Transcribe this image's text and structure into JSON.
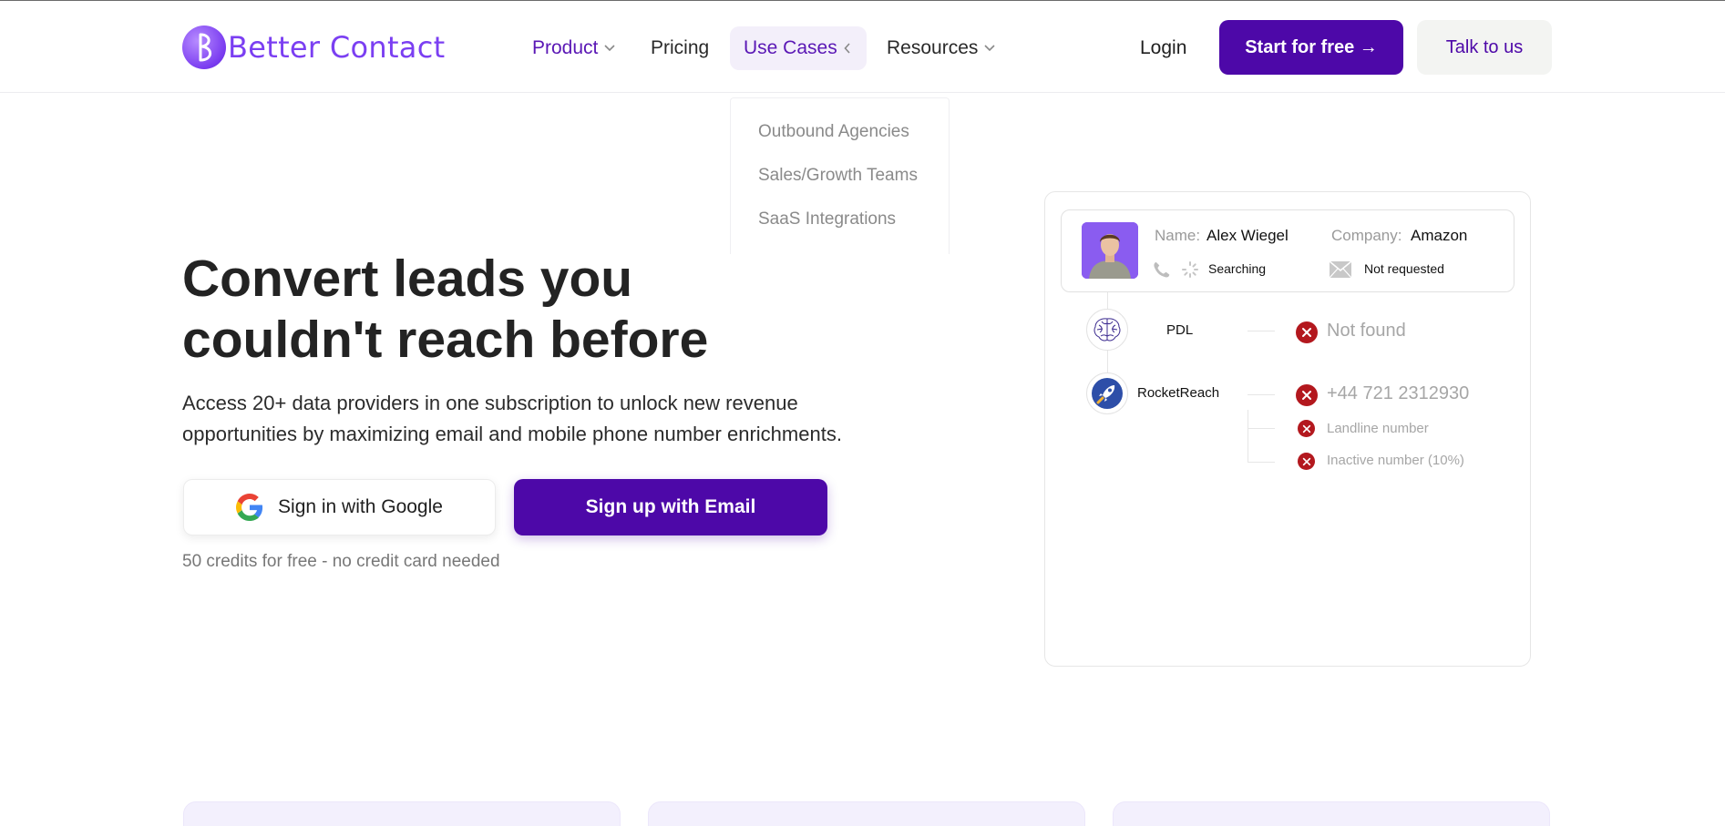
{
  "brand": {
    "name": "Better Contact",
    "accent": "#7b3ff2",
    "primary": "#4d08a8"
  },
  "nav": {
    "product": "Product",
    "pricing": "Pricing",
    "use_cases": "Use Cases",
    "resources": "Resources",
    "login": "Login",
    "start": "Start for free →",
    "talk": "Talk to us"
  },
  "use_cases_menu": [
    "Outbound Agencies",
    "Sales/Growth Teams",
    "SaaS Integrations"
  ],
  "hero": {
    "title_line1": "Convert leads you",
    "title_line2": "couldn't reach before",
    "subtitle_line1": "Access 20+ data providers in one subscription to unlock new revenue",
    "subtitle_line2": "opportunities by maximizing email and mobile phone number enrichments.",
    "google_button": "Sign in with Google",
    "email_button": "Sign up with Email",
    "note": "50 credits for free - no credit card needed"
  },
  "demo_card": {
    "name_label": "Name:",
    "name_value": "Alex Wiegel",
    "company_label": "Company:",
    "company_value": "Amazon",
    "phone_status": "Searching",
    "email_status": "Not requested",
    "providers": [
      {
        "name": "PDL",
        "result": "Not found",
        "icon": "brain-icon"
      },
      {
        "name": "RocketReach",
        "result": "+44 721 2312930",
        "icon": "rocket-icon",
        "sub_results": [
          "Landline number",
          "Inactive number (10%)"
        ]
      }
    ]
  }
}
